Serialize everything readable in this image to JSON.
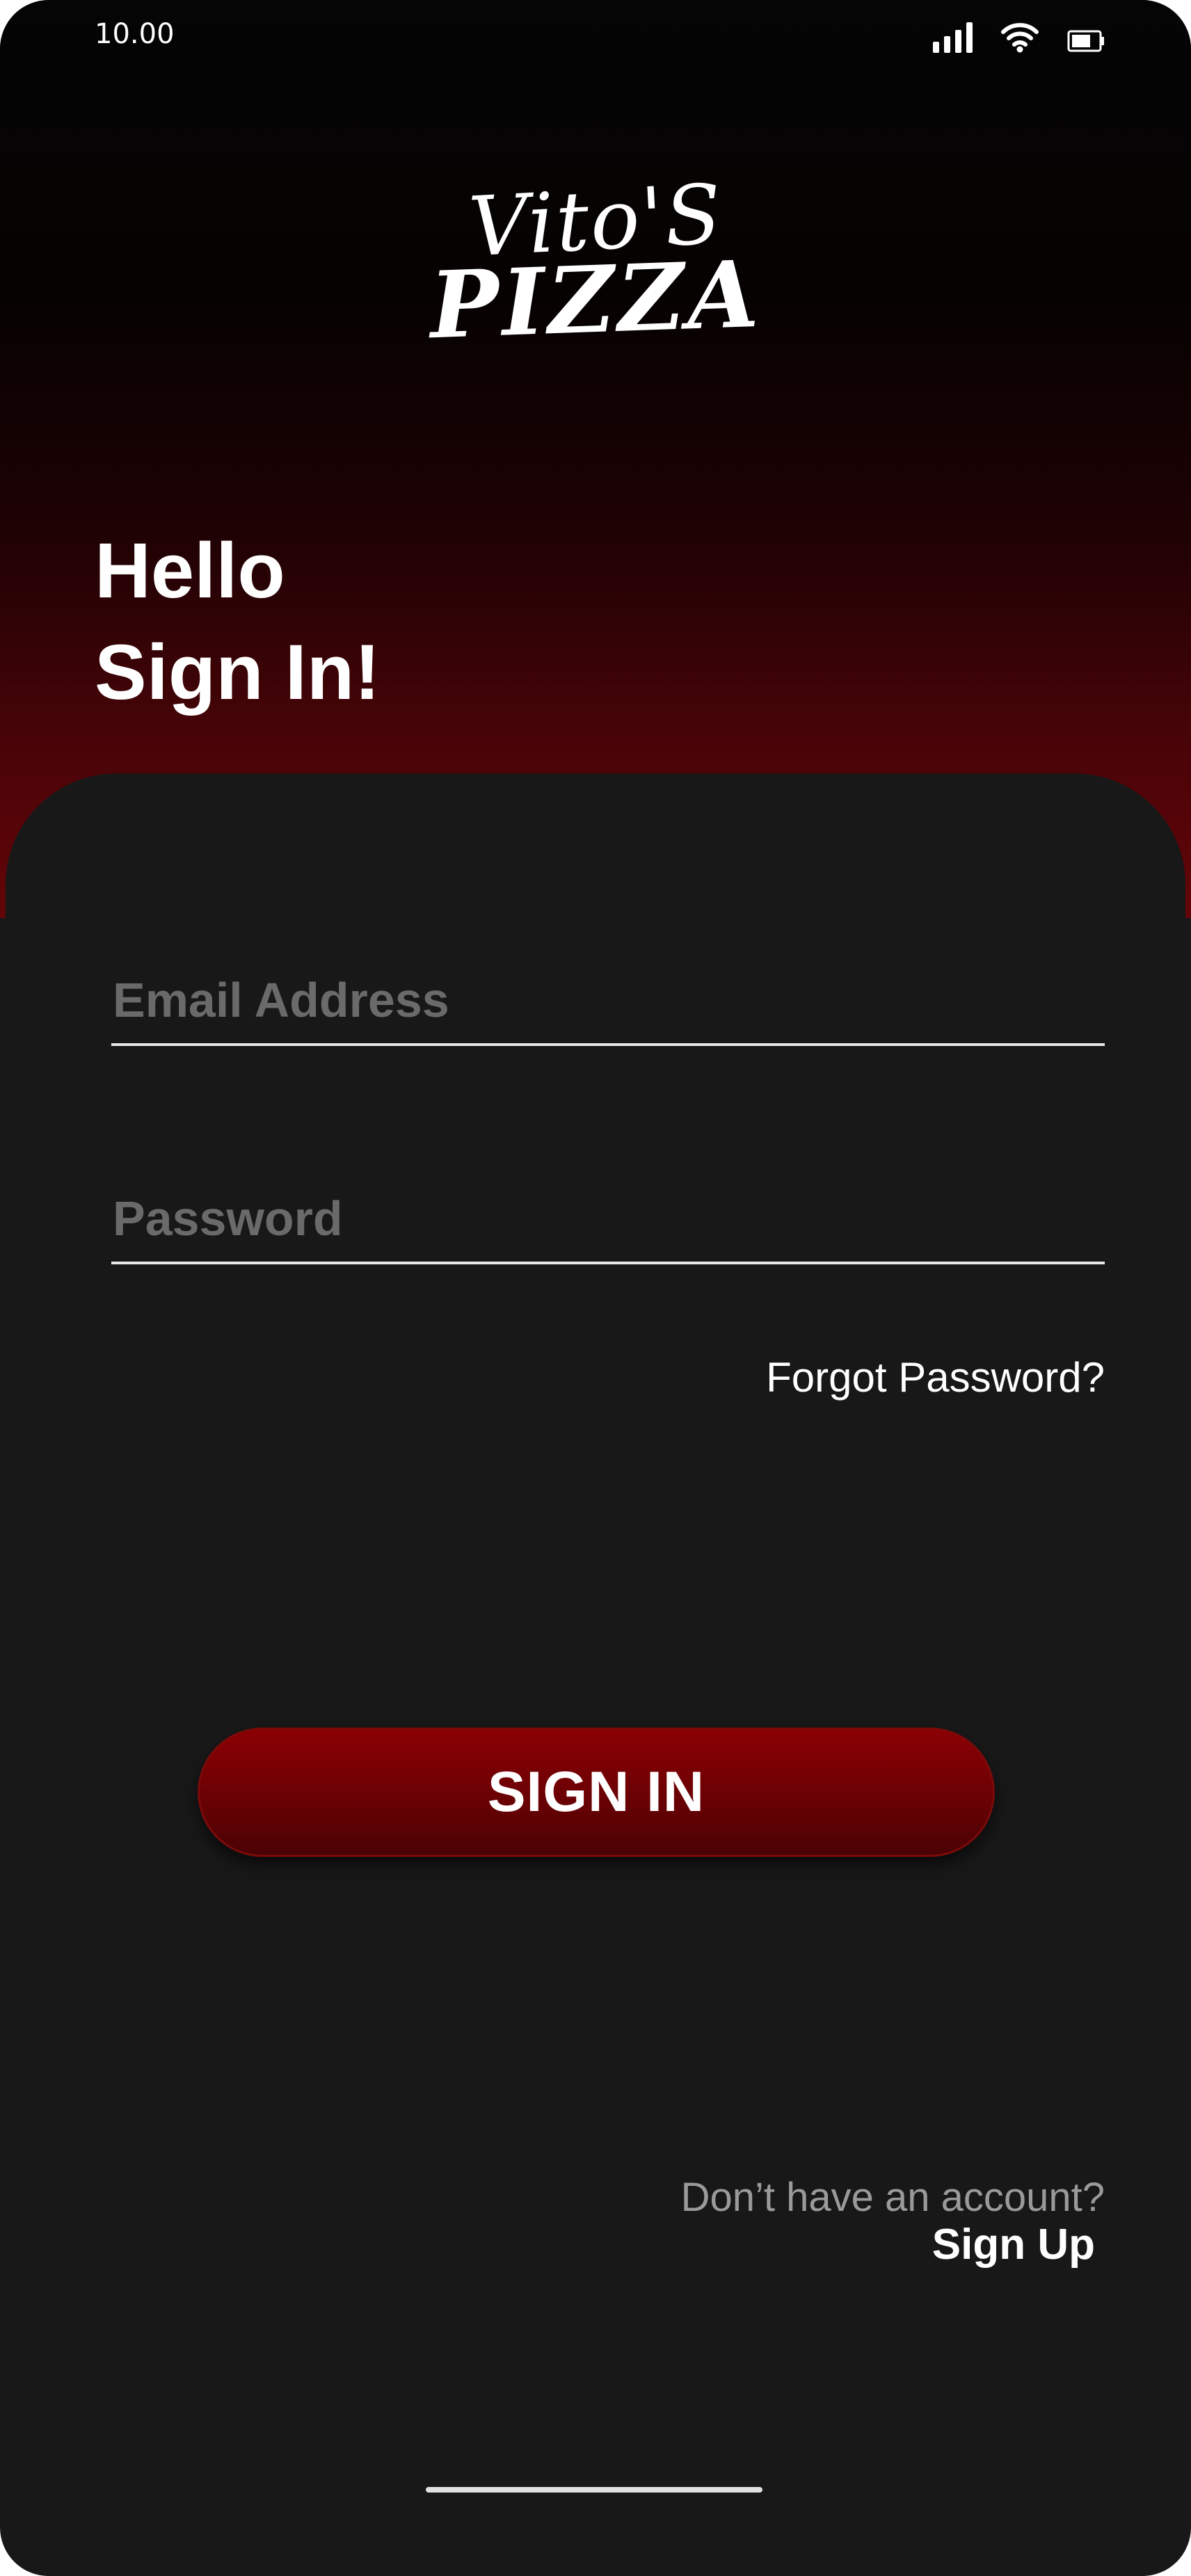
{
  "status_bar": {
    "time": "10.00",
    "icons": [
      "signal-icon",
      "wifi-icon",
      "battery-icon"
    ]
  },
  "logo": {
    "line1": "Vito'S",
    "line2": "PIZZA"
  },
  "greeting": {
    "line1": "Hello",
    "line2": "Sign In!"
  },
  "form": {
    "email_placeholder": "Email Address",
    "email_value": "",
    "password_placeholder": "Password",
    "password_value": "",
    "forgot_label": "Forgot Password?",
    "submit_label": "SIGN IN"
  },
  "footer": {
    "prompt": "Don’t have an account?",
    "signup_label": "Sign Up"
  },
  "colors": {
    "background": "#181818",
    "accent": "#8b0004",
    "text": "#ffffff",
    "muted": "#9a9a9a"
  }
}
